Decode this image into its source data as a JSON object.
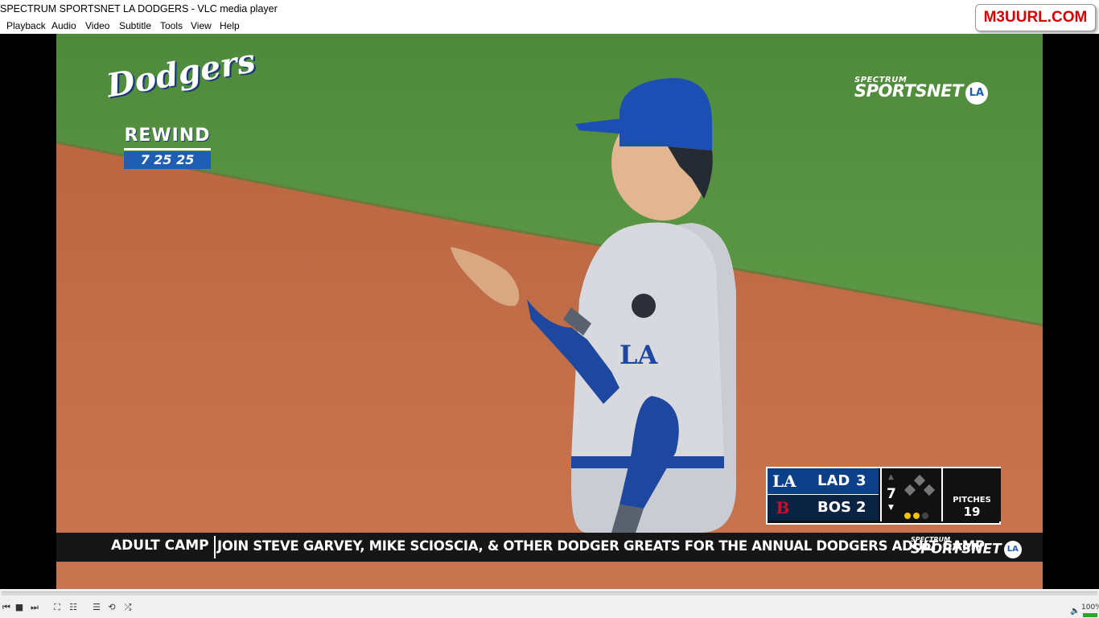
{
  "window": {
    "title": "SPECTRUM SPORTSNET LA DODGERS - VLC media player"
  },
  "menu": [
    "Playback",
    "Audio",
    "Video",
    "Subtitle",
    "Tools",
    "View",
    "Help"
  ],
  "watermark": "M3UURL.COM",
  "overlay": {
    "logo_script": "Dodgers",
    "rewind_label": "REWIND",
    "rewind_date": "7 25 25",
    "network_small": "SPECTRUM",
    "network_big": "SPORTSNET",
    "network_badge": "LA"
  },
  "scorebug": {
    "away": {
      "abbr": "LAD",
      "score": "3",
      "logo": "LA"
    },
    "home": {
      "abbr": "BOS",
      "score": "2",
      "logo": "B"
    },
    "inning": "7",
    "pitches_label": "PITCHES",
    "pitches": "19",
    "colors": {
      "away": "#0b3f88",
      "home": "#0b2342",
      "outs": "#f2c300"
    }
  },
  "ticker": {
    "label": "ADULT CAMP",
    "text": "JOIN STEVE GARVEY, MIKE SCIOSCIA, & OTHER DODGER GREATS FOR THE ANNUAL DODGERS ADULT CAMP",
    "network_small": "SPECTRUM",
    "network_big": "SPORTSNET",
    "network_badge": "LA"
  },
  "controls": {
    "icons": [
      "prev-icon",
      "stop-icon",
      "next-icon",
      "fullscreen-icon",
      "extended-settings-icon",
      "playlist-icon",
      "loop-icon",
      "shuffle-icon"
    ],
    "volume": "100%"
  }
}
